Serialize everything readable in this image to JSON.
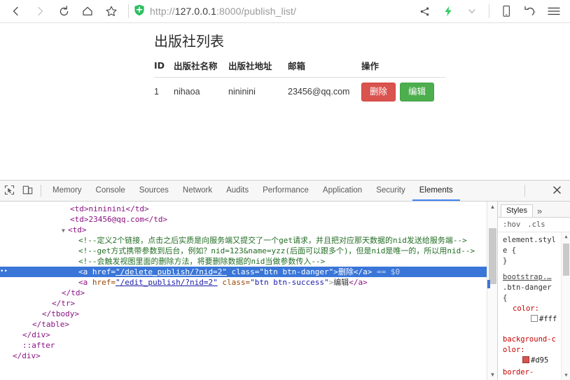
{
  "browser": {
    "back_icon": "chevron-left-icon",
    "forward_icon": "chevron-right-icon",
    "reload_icon": "reload-icon",
    "home_icon": "home-icon",
    "bookmark_icon": "star-icon",
    "security_icon": "green-shield-icon",
    "url_scheme": "http://",
    "url_host": "127.0.0.1",
    "url_rest": ":8000/publish_list/",
    "share_icon": "share-icon",
    "lightning_icon": "lightning-bolt-icon",
    "chevron_icon": "chevron-down-icon",
    "mobile_icon": "mobile-device-icon",
    "history_icon": "undo-history-icon",
    "menu_icon": "hamburger-menu-icon"
  },
  "page": {
    "title": "出版社列表",
    "table": {
      "headers": [
        "ID",
        "出版社名称",
        "出版社地址",
        "邮箱",
        "操作"
      ],
      "rows": [
        {
          "id": "1",
          "name": "nihaoa",
          "address": "nininini",
          "email": "23456@qq.com",
          "delete_label": "删除",
          "edit_label": "编辑"
        }
      ]
    },
    "colors": {
      "danger": "#d9534f",
      "success": "#4cae4c"
    }
  },
  "devtools": {
    "inspect_icon": "inspect-element-icon",
    "device_icon": "device-toolbar-icon",
    "tabs": [
      {
        "label": "Memory",
        "active": false
      },
      {
        "label": "Console",
        "active": false
      },
      {
        "label": "Sources",
        "active": false
      },
      {
        "label": "Network",
        "active": false
      },
      {
        "label": "Audits",
        "active": false
      },
      {
        "label": "Performance",
        "active": false
      },
      {
        "label": "Application",
        "active": false
      },
      {
        "label": "Security",
        "active": false
      },
      {
        "label": "Elements",
        "active": true
      }
    ],
    "more_icon": "kebab-menu-icon",
    "close_icon": "close-icon",
    "dom": {
      "line_td_address": "<td>nininini</td>",
      "line_td_email": "<td>23456@qq.com</td>",
      "line_td_open": "<td>",
      "comment1": "<!--定义2个链接，点击之后实质是向服务端又提交了一个get请求，并且把对应那天数据的nid发送给服务端-->",
      "comment2": "<!--get方式携带参数到后台，例如？nid=123&name=yzz(后面可以跟多个)，但是nid是唯一的，所以用nid-->",
      "comment3": "<!--会触发视图里面的删除方法，将要删除数据的nid当做参数传入-->",
      "selected_link": {
        "tag_open": "<a",
        "attr_href": "href=",
        "href_value": "\"/delete_publish/?nid=2\"",
        "attr_class": "class=",
        "class_value": "\"btn btn-danger\"",
        "gt": ">",
        "text": "删除",
        "tag_close": "</a>",
        "selected_marker": "== $0"
      },
      "edit_link": {
        "tag_open": "<a",
        "attr_href": "href=",
        "href_value": "\"/edit_publish/?nid=2\"",
        "attr_class": "class=",
        "class_value": "\"btn btn-success\"",
        "gt": ">",
        "text": "编辑",
        "tag_close": "</a>"
      },
      "close_td": "</td>",
      "close_tr": "</tr>",
      "close_tbody": "</tbody>",
      "close_table": "</table>",
      "close_div1": "</div>",
      "pseudo_after": "::after",
      "close_div2": "</div>"
    },
    "styles": {
      "tab_label": "Styles",
      "more_label": "»",
      "hov_label": ":hov",
      "cls_label": ".cls",
      "element_style": "element.style {",
      "element_style_close": "}",
      "source_link": "bootstrap.…",
      "selector": ".btn-danger",
      "brace_open": "{",
      "prop_color_name": "color:",
      "prop_color_value": "#fff",
      "prop_bg_name": "background-color:",
      "prop_bg_value": "#d95",
      "prop_border_name": "border-",
      "color_swatch_white": "#ffffff",
      "color_swatch_red": "#d9534f"
    }
  }
}
